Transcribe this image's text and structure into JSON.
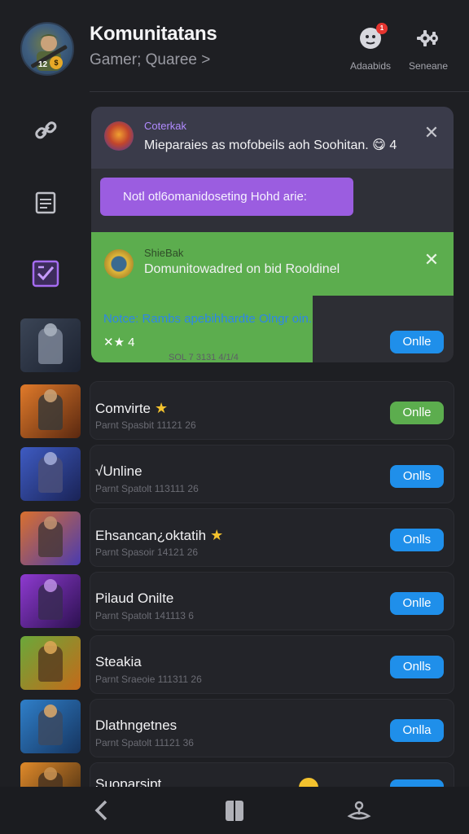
{
  "header": {
    "title": "Komunitatans",
    "subtitle": "Gamer; Quaree >",
    "avatar_level": "12",
    "actions": [
      {
        "label": "Adaabids",
        "icon": "notification-bell-icon",
        "badge": "1"
      },
      {
        "label": "Seneane",
        "icon": "settings-gear-icon"
      }
    ]
  },
  "rail": {
    "icons": [
      "link-icon",
      "document-icon",
      "checklist-icon"
    ]
  },
  "notifications": {
    "first": {
      "label": "Coterkak",
      "text": "Mieparaies as mofobeils aoh Soohitan.",
      "emoji": "😋",
      "count": "4"
    },
    "purple_button": "Notl otl6omanidoseting Hohd arie:",
    "second": {
      "label": "ShieBak",
      "text": "Domunitowadred on bid Rooldinel"
    },
    "footer": {
      "notice": "Notce: Rambs apebihhardte Olngr oin.",
      "rating": "✕★ 4",
      "faded": "SOL 7 3131 4/1/4",
      "button": "Onlle"
    }
  },
  "games": [
    {
      "title": "Comvirte",
      "star": true,
      "sub": "Parnt  Spasbit 11121 26",
      "button": "Onlle",
      "button_color": "#5cad4e"
    },
    {
      "title": "√Unline",
      "star": false,
      "sub": "Parnt  Spatolt 113111 26",
      "button": "Onlls",
      "button_color": "#1f8fea"
    },
    {
      "title": "Ehsancan¿oktatih",
      "star": true,
      "sub": "Parnt  Spasoir 14121 26",
      "button": "Onlls",
      "button_color": "#1f8fea"
    },
    {
      "title": "Pilaud Onilte",
      "star": false,
      "sub": "Parnt  Spatolt 141113 6",
      "button": "Onlle",
      "button_color": "#1f8fea"
    },
    {
      "title": "Steakia",
      "star": false,
      "sub": "Parnt  Sraeoie 111311 26",
      "button": "Onlls",
      "button_color": "#1f8fea"
    },
    {
      "title": "Dlathngetnes",
      "star": false,
      "sub": "Parnt  Spatolt 11121 36",
      "button": "Onlla",
      "button_color": "#1f8fea"
    }
  ],
  "partial_row": {
    "title": "Suoparsipt"
  },
  "thumbs": [
    {
      "bg1": "#3b4556",
      "bg2": "#1c2230",
      "fig": "#7b8597",
      "head": "#a7b0bd"
    },
    {
      "bg1": "#e07a2a",
      "bg2": "#5a2810",
      "fig": "#3c3a36",
      "head": "#c9a073"
    },
    {
      "bg1": "#3e5bc2",
      "bg2": "#1a2356",
      "fig": "#4a4f7a",
      "head": "#9ea8d6"
    },
    {
      "bg1": "#d9702e",
      "bg2": "#4a3bb0",
      "fig": "#4b3a3a",
      "head": "#c09070"
    },
    {
      "bg1": "#8e3ad0",
      "bg2": "#2c1150",
      "fig": "#3a2a55",
      "head": "#b88ae0"
    },
    {
      "bg1": "#6aa83a",
      "bg2": "#c46a1a",
      "fig": "#5a3f20",
      "head": "#d8a555"
    },
    {
      "bg1": "#2f7fc9",
      "bg2": "#163560",
      "fig": "#3b4a63",
      "head": "#d5a56a"
    },
    {
      "bg1": "#e08a2a",
      "bg2": "#3a2510",
      "fig": "#4a3420",
      "head": "#c79050"
    }
  ],
  "bottom_bar": {
    "icons": [
      "back-chevron-icon",
      "book-icon",
      "joystick-icon"
    ]
  }
}
